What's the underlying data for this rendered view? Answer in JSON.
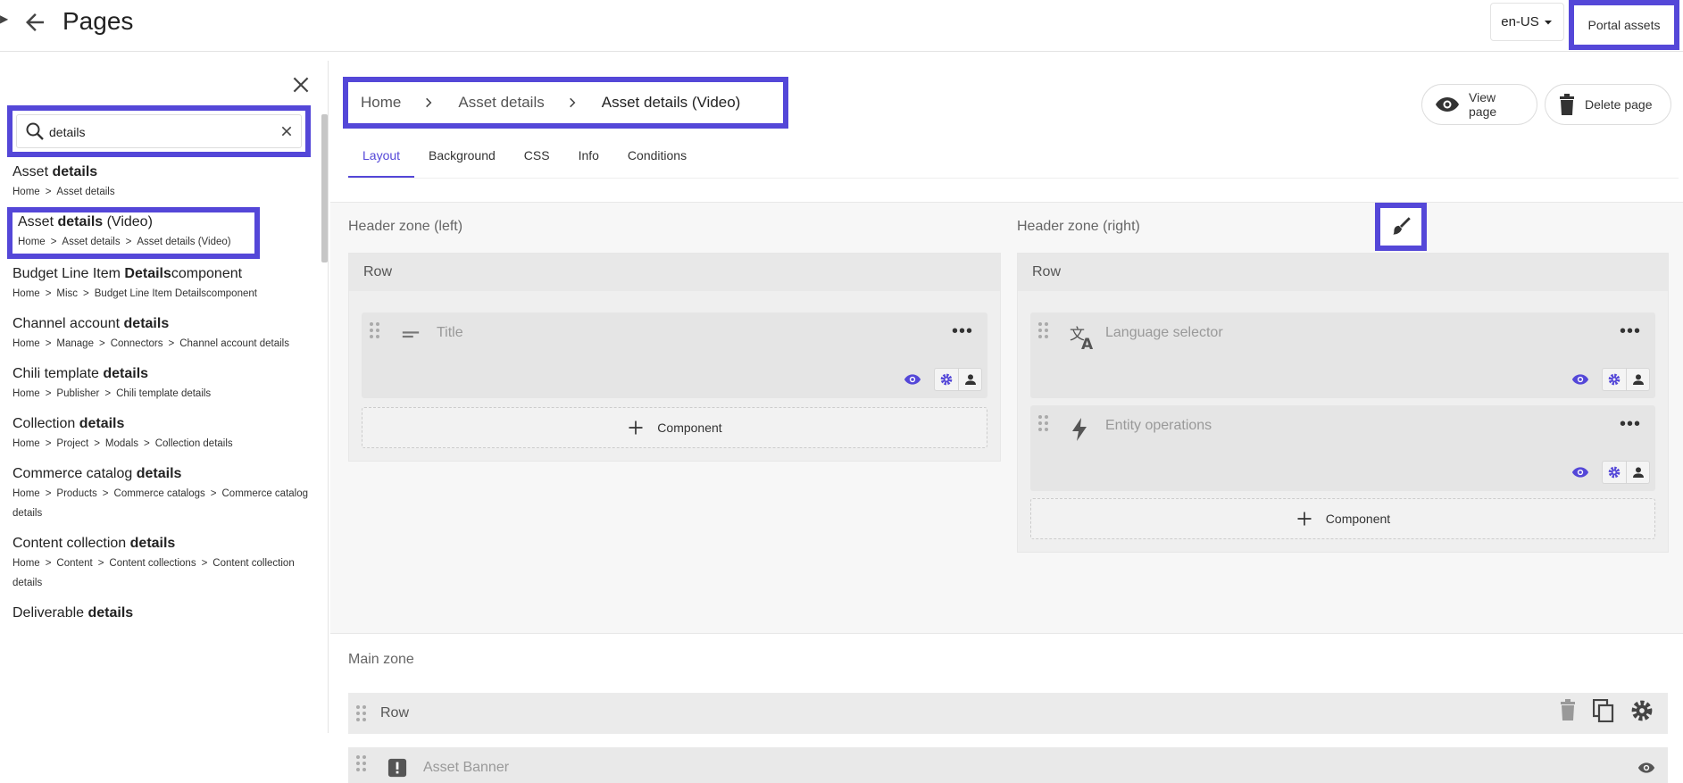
{
  "header": {
    "title": "Pages",
    "locale": "en-US",
    "portal_assets": "Portal assets"
  },
  "sidebar": {
    "search": {
      "value": "details",
      "placeholder": ""
    },
    "results": [
      {
        "pre": "Asset ",
        "bold": "details",
        "post": "",
        "path": [
          "Home",
          "Asset details"
        ]
      },
      {
        "pre": "Asset ",
        "bold": "details",
        "post": " (Video)",
        "path": [
          "Home",
          "Asset details",
          "Asset details (Video)"
        ]
      },
      {
        "pre": "Budget Line Item ",
        "bold": "Details",
        "post": "component",
        "path": [
          "Home",
          "Misc",
          "Budget Line Item Detailscomponent"
        ]
      },
      {
        "pre": "Channel account ",
        "bold": "details",
        "post": "",
        "path": [
          "Home",
          "Manage",
          "Connectors",
          "Channel account details"
        ]
      },
      {
        "pre": "Chili template ",
        "bold": "details",
        "post": "",
        "path": [
          "Home",
          "Publisher",
          "Chili template details"
        ]
      },
      {
        "pre": "Collection ",
        "bold": "details",
        "post": "",
        "path": [
          "Home",
          "Project",
          "Modals",
          "Collection details"
        ]
      },
      {
        "pre": "Commerce catalog ",
        "bold": "details",
        "post": "",
        "path": [
          "Home",
          "Products",
          "Commerce catalogs",
          "Commerce catalog details"
        ]
      },
      {
        "pre": "Content collection ",
        "bold": "details",
        "post": "",
        "path": [
          "Home",
          "Content",
          "Content collections",
          "Content collection details"
        ]
      },
      {
        "pre": "Deliverable ",
        "bold": "details",
        "post": "",
        "path": []
      }
    ]
  },
  "breadcrumb": {
    "home": "Home",
    "parent": "Asset details",
    "current": "Asset details (Video)"
  },
  "actions": {
    "view_page": "View page",
    "delete_page": "Delete page"
  },
  "tabs": [
    "Layout",
    "Background",
    "CSS",
    "Info",
    "Conditions"
  ],
  "zones": {
    "header_left": {
      "label": "Header zone (left)",
      "row": "Row",
      "components": [
        {
          "name": "Title",
          "icon": "title-icon"
        }
      ],
      "add": "Component"
    },
    "header_right": {
      "label": "Header zone (right)",
      "row": "Row",
      "components": [
        {
          "name": "Language selector",
          "icon": "translate-icon"
        },
        {
          "name": "Entity operations",
          "icon": "bolt-icon"
        }
      ],
      "add": "Component"
    },
    "main": {
      "label": "Main zone",
      "row": "Row",
      "components": [
        {
          "name": "Asset Banner",
          "icon": "alert-icon"
        }
      ]
    }
  },
  "colors": {
    "accent": "#5447d8",
    "highlight_border": "#5447d8"
  }
}
